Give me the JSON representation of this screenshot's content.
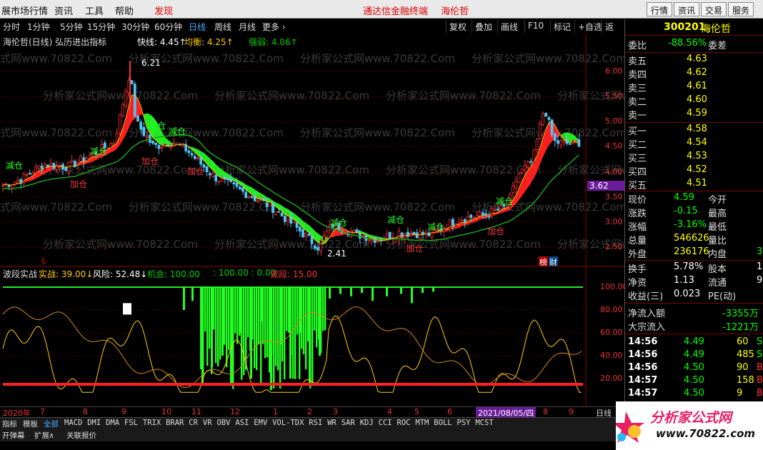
{
  "menubar": {
    "items": [
      "展市场行情",
      "资讯",
      "工具",
      "帮助",
      "发现"
    ],
    "brand": "通达信金融终端",
    "stock_name": "海伦哲",
    "right_buttons": [
      "行情",
      "资讯",
      "交易",
      "服务"
    ]
  },
  "periodbar": {
    "periods": [
      "分时",
      "1分钟",
      "5分钟",
      "15分钟",
      "30分钟",
      "60分钟",
      "日线",
      "周线",
      "月线",
      "更多 ›"
    ],
    "active": "日线",
    "tools": [
      "复权",
      "叠加",
      "画线",
      "F10",
      "标记",
      "+自选",
      "返回"
    ]
  },
  "mainchart": {
    "title": "海伦哲(日线) 弘历进出指标",
    "fast_label": "快线: 4.45↑",
    "avg_label": "均衡: 4.25↑",
    "strength_label": "强弱: 4.06↑",
    "high_label": "6.21",
    "low_label": "2.41",
    "price_marker": "3.62",
    "signals_jian": "减仓",
    "signals_jia": "加仓",
    "badge_bang": "榜",
    "badge_cai": "财",
    "s_mark": "§",
    "watermark": "分析家公式网www.70822.Com",
    "y_ticks": [
      "6.00",
      "5.50",
      "5.00",
      "4.50",
      "4.00",
      "3.50",
      "3.00",
      "2.50"
    ]
  },
  "subchart": {
    "title": "波段实战",
    "shizhan": "实战: 39.00↓",
    "fengxian": "风险: 52.48↓",
    "jihui": "机会: 100.00",
    "mid": ": 100.00 : 0.00",
    "boduan": "波段: 15.00",
    "y_ticks": [
      "100.00",
      "80.00",
      "60.00",
      "40.00",
      "20.00"
    ]
  },
  "chart_data": [
    {
      "type": "candlestick",
      "title": "",
      "y_ticks": [
        6.0,
        5.5,
        5.0,
        4.5,
        4.0,
        3.5,
        3.0,
        2.5
      ],
      "ylim": [
        2.2,
        6.5
      ],
      "annotations": {
        "high": 6.21,
        "low": 2.41,
        "current_marker": 3.62
      },
      "indicator": {
        "fast": 4.45,
        "avg": 4.25,
        "strength": 4.06
      }
    },
    {
      "type": "area",
      "title": "",
      "y_ticks": [
        100,
        80,
        60,
        40,
        20
      ],
      "ylim": [
        0,
        105
      ],
      "values": {
        "shizhan": 39.0,
        "fengxian": 52.48,
        "jihui": 100.0,
        "boduan": 15.0
      }
    }
  ],
  "datebar": {
    "labels": [
      "2020年",
      "7",
      "8",
      "9",
      "10",
      "11",
      "12",
      "1",
      "2",
      "3",
      "4",
      "5",
      "6",
      "7",
      "8",
      "9"
    ],
    "cursor_date": "2021/08/05/四",
    "right": "日线"
  },
  "tabbar1": {
    "items": [
      "指标",
      "模板",
      "全部",
      "MACD",
      "DMI",
      "DMA",
      "FSL",
      "TRIX",
      "BRAR",
      "CR",
      "VR",
      "OBV",
      "ASI",
      "EMV",
      "VOL-TDX",
      "RSI",
      "WR",
      "SAR",
      "KDJ",
      "CCI",
      "ROC",
      "MTM",
      "BOLL",
      "PSY",
      "MCST"
    ],
    "active": "全部"
  },
  "tabbar2": {
    "items": [
      "开弹幕",
      "扩展∧",
      "关联报价"
    ]
  },
  "rightpanel": {
    "code": "300201",
    "name": "海伦哲",
    "weibi_label": "委比",
    "weibi_value": "-88.56%",
    "weicha_label": "委差",
    "sell": [
      {
        "label": "卖五",
        "price": "4.63"
      },
      {
        "label": "卖四",
        "price": "4.62"
      },
      {
        "label": "卖三",
        "price": "4.61"
      },
      {
        "label": "卖二",
        "price": "4.60"
      },
      {
        "label": "卖一",
        "price": "4.59"
      }
    ],
    "buy": [
      {
        "label": "买一",
        "price": "4.58"
      },
      {
        "label": "买二",
        "price": "4.54"
      },
      {
        "label": "买三",
        "price": "4.53"
      },
      {
        "label": "买四",
        "price": "4.52"
      },
      {
        "label": "买五",
        "price": "4.51"
      }
    ],
    "quote": [
      {
        "l": "现价",
        "v": "4.59",
        "r": "今开"
      },
      {
        "l": "涨跌",
        "v": "-0.15",
        "r": "最高"
      },
      {
        "l": "涨幅",
        "v": "-3.16%",
        "r": "最低"
      },
      {
        "l": "总量",
        "v": "546626",
        "r": "量比"
      },
      {
        "l": "外盘",
        "v": "236176",
        "r": "内盘",
        "rv": "3"
      }
    ],
    "stats": [
      {
        "l": "换手",
        "v": "5.78%",
        "r": "股本",
        "rv": "1"
      },
      {
        "l": "净资",
        "v": "1.13",
        "r": "流通",
        "rv": "9"
      },
      {
        "l": "收益(三)",
        "v": "0.023",
        "r": "PE(动)"
      }
    ],
    "flow": [
      {
        "l": "净流入额",
        "v": "-3355万"
      },
      {
        "l": "大宗流入",
        "v": "-1221万"
      }
    ],
    "ticks": [
      {
        "t": "14:56",
        "p": "4.49",
        "q": "60",
        "f": "S"
      },
      {
        "t": "14:56",
        "p": "4.49",
        "q": "485",
        "f": "S"
      },
      {
        "t": "14:56",
        "p": "4.50",
        "q": "90",
        "f": "B"
      },
      {
        "t": "14:57",
        "p": "4.50",
        "q": "158",
        "f": "B"
      },
      {
        "t": "14:57",
        "p": "4.50",
        "q": "9",
        "f": "B"
      }
    ]
  },
  "logo": {
    "text": "分析家公式网",
    "url": "www.70822.com"
  }
}
